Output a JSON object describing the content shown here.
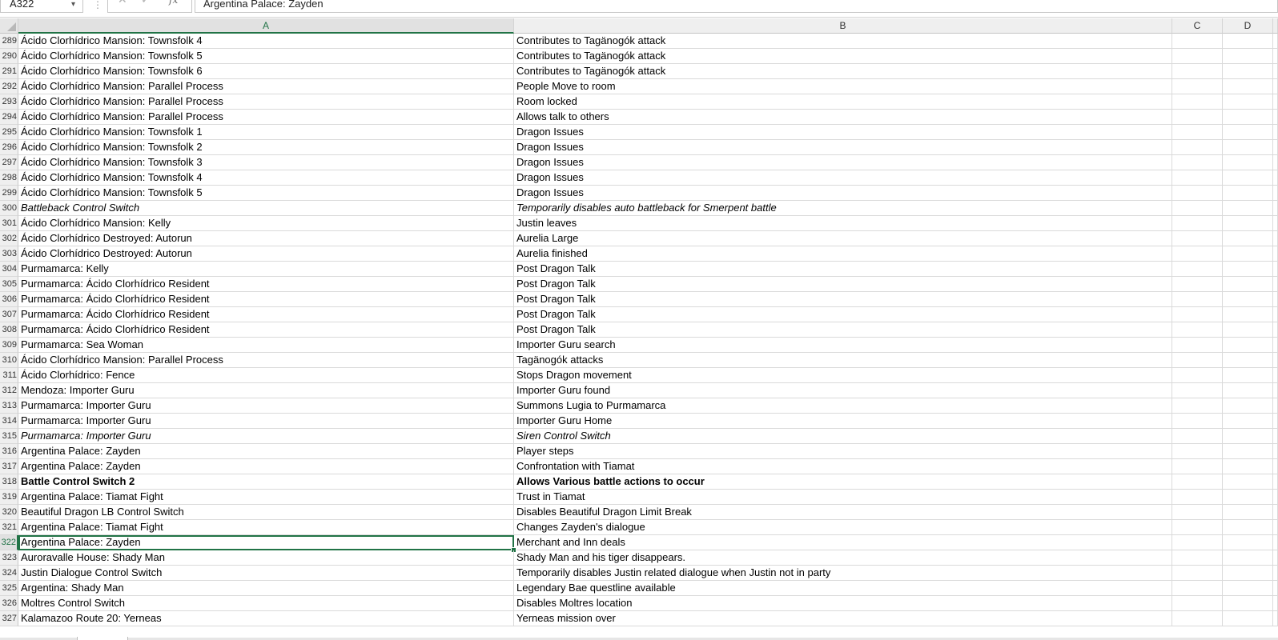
{
  "formula_bar": {
    "name_box": "A322",
    "cancel_icon": "✕",
    "enter_icon": "✓",
    "fx_label": "fx",
    "formula_value": "Argentina Palace: Zayden"
  },
  "columns": [
    "A",
    "B",
    "C",
    "D"
  ],
  "selected_cell": "A322",
  "rows": [
    {
      "num": "289",
      "a": "Ácido Clorhídrico Mansion: Townsfolk 4",
      "b": "Contributes to Tagänogók attack",
      "style": "normal"
    },
    {
      "num": "290",
      "a": "Ácido Clorhídrico Mansion: Townsfolk 5",
      "b": "Contributes to Tagänogók attack",
      "style": "normal"
    },
    {
      "num": "291",
      "a": "Ácido Clorhídrico Mansion: Townsfolk 6",
      "b": "Contributes to Tagänogók attack",
      "style": "normal"
    },
    {
      "num": "292",
      "a": "Ácido Clorhídrico Mansion: Parallel Process",
      "b": "People Move to room",
      "style": "normal"
    },
    {
      "num": "293",
      "a": "Ácido Clorhídrico Mansion: Parallel Process",
      "b": " Room locked",
      "style": "normal"
    },
    {
      "num": "294",
      "a": "Ácido Clorhídrico Mansion: Parallel Process",
      "b": "Allows talk to others",
      "style": "normal"
    },
    {
      "num": "295",
      "a": "Ácido Clorhídrico Mansion: Townsfolk 1",
      "b": "Dragon Issues",
      "style": "normal"
    },
    {
      "num": "296",
      "a": "Ácido Clorhídrico Mansion: Townsfolk 2",
      "b": "Dragon Issues",
      "style": "normal"
    },
    {
      "num": "297",
      "a": "Ácido Clorhídrico Mansion: Townsfolk 3",
      "b": "Dragon Issues",
      "style": "normal"
    },
    {
      "num": "298",
      "a": "Ácido Clorhídrico Mansion: Townsfolk 4",
      "b": "Dragon Issues",
      "style": "normal"
    },
    {
      "num": "299",
      "a": "Ácido Clorhídrico Mansion: Townsfolk 5",
      "b": "Dragon Issues",
      "style": "normal"
    },
    {
      "num": "300",
      "a": "Battleback Control Switch",
      "b": "Temporarily disables auto battleback for Smerpent battle",
      "style": "italic"
    },
    {
      "num": "301",
      "a": "Ácido Clorhídrico Mansion: Kelly",
      "b": "Justin leaves",
      "style": "normal"
    },
    {
      "num": "302",
      "a": "Ácido Clorhídrico Destroyed: Autorun",
      "b": "Aurelia Large",
      "style": "normal"
    },
    {
      "num": "303",
      "a": "Ácido Clorhídrico Destroyed: Autorun",
      "b": "Aurelia finished",
      "style": "normal"
    },
    {
      "num": "304",
      "a": "Purmamarca: Kelly",
      "b": "Post Dragon Talk",
      "style": "normal"
    },
    {
      "num": "305",
      "a": "Purmamarca: Ácido Clorhídrico Resident",
      "b": "Post Dragon Talk",
      "style": "normal"
    },
    {
      "num": "306",
      "a": "Purmamarca: Ácido Clorhídrico Resident",
      "b": "Post Dragon Talk",
      "style": "normal"
    },
    {
      "num": "307",
      "a": "Purmamarca: Ácido Clorhídrico Resident",
      "b": "Post Dragon Talk",
      "style": "normal"
    },
    {
      "num": "308",
      "a": "Purmamarca: Ácido Clorhídrico Resident",
      "b": "Post Dragon Talk",
      "style": "normal"
    },
    {
      "num": "309",
      "a": "Purmamarca: Sea Woman",
      "b": "Importer Guru search",
      "style": "normal"
    },
    {
      "num": "310",
      "a": "Ácido Clorhídrico Mansion: Parallel Process",
      "b": "Tagänogók attacks",
      "style": "normal"
    },
    {
      "num": "311",
      "a": "Ácido Clorhídrico: Fence",
      "b": "Stops Dragon movement",
      "style": "normal"
    },
    {
      "num": "312",
      "a": "Mendoza: Importer Guru",
      "b": "Importer Guru found",
      "style": "normal"
    },
    {
      "num": "313",
      "a": "Purmamarca: Importer Guru",
      "b": "Summons Lugia to Purmamarca",
      "style": "normal"
    },
    {
      "num": "314",
      "a": "Purmamarca: Importer Guru",
      "b": "Importer Guru Home",
      "style": "normal"
    },
    {
      "num": "315",
      "a": "Purmamarca: Importer Guru",
      "b": "Siren Control Switch",
      "style": "italic"
    },
    {
      "num": "316",
      "a": "Argentina Palace: Zayden",
      "b": "Player steps",
      "style": "normal"
    },
    {
      "num": "317",
      "a": "Argentina Palace: Zayden",
      "b": "Confrontation with Tiamat",
      "style": "normal"
    },
    {
      "num": "318",
      "a": "Battle Control Switch 2",
      "b": "Allows Various battle actions to occur",
      "style": "bold"
    },
    {
      "num": "319",
      "a": "Argentina Palace: Tiamat Fight",
      "b": "Trust in Tiamat",
      "style": "normal"
    },
    {
      "num": "320",
      "a": "Beautiful Dragon LB Control Switch",
      "b": "Disables Beautiful Dragon Limit Break",
      "style": "normal"
    },
    {
      "num": "321",
      "a": "Argentina Palace: Tiamat Fight",
      "b": "Changes Zayden's dialogue",
      "style": "normal"
    },
    {
      "num": "322",
      "a": "Argentina Palace: Zayden",
      "b": "Merchant and Inn deals",
      "style": "normal"
    },
    {
      "num": "323",
      "a": "Auroravalle House: Shady Man",
      "b": "Shady Man and his tiger disappears.",
      "style": "normal"
    },
    {
      "num": "324",
      "a": "Justin Dialogue Control Switch",
      "b": "Temporarily disables Justin related dialogue when Justin not in party",
      "style": "normal"
    },
    {
      "num": "325",
      "a": "Argentina: Shady Man",
      "b": "Legendary Bae questline available",
      "style": "normal"
    },
    {
      "num": "326",
      "a": "Moltres Control Switch",
      "b": "Disables Moltres location",
      "style": "normal"
    },
    {
      "num": "327",
      "a": "Kalamazoo Route 20: Yerneas",
      "b": "Yerneas mission over",
      "style": "normal"
    }
  ],
  "colors": {
    "accent": "#217346",
    "header_bg": "#efefef",
    "gridline": "#dadada"
  }
}
